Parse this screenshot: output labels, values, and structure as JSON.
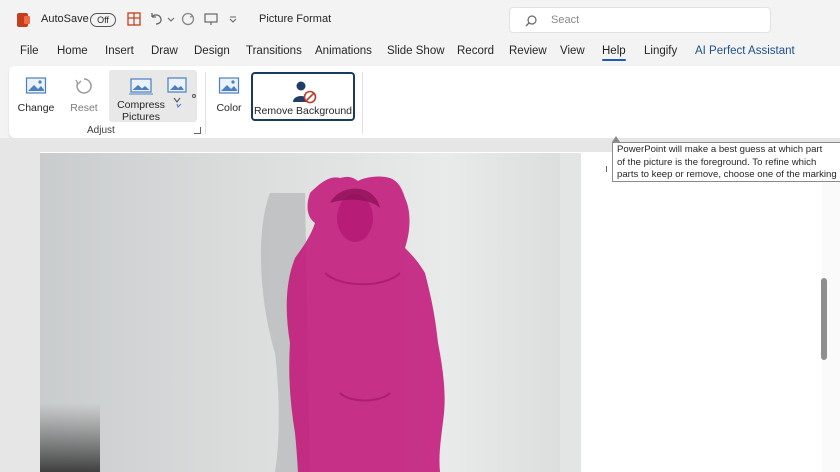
{
  "titlebar": {
    "autosave_label": "AutoSave",
    "autosave_state": "Off",
    "document_title": "Picture Format",
    "search_placeholder": "Seact"
  },
  "tabs": [
    {
      "label": "File"
    },
    {
      "label": "Home"
    },
    {
      "label": "Insert"
    },
    {
      "label": "Draw"
    },
    {
      "label": "Design"
    },
    {
      "label": "Transitions"
    },
    {
      "label": "Animations"
    },
    {
      "label": "Slide Show"
    },
    {
      "label": "Record"
    },
    {
      "label": "Review"
    },
    {
      "label": "View"
    },
    {
      "label": "Help"
    },
    {
      "label": "Lingify"
    },
    {
      "label": "AI Perfect Assistant"
    }
  ],
  "ribbon": {
    "change_label": "Change",
    "reset_label": "Reset",
    "compress_label_1": "Compress",
    "compress_label_2": "Pictures",
    "adjust_group_label": "Adjust",
    "color_label": "Color",
    "remove_background_label": "Remove Background"
  },
  "tooltip": {
    "line1": "PowerPoint will make a best guess at which part",
    "line2": "of the picture is the foreground. To refine which",
    "line3": "parts to keep or remove, choose one of the marking"
  },
  "colors": {
    "accent": "#1e5bb6",
    "brand_tab": "#1f4f8c",
    "removal_highlight": "#c2187a",
    "remove_bg_border": "#1b3a5c"
  }
}
